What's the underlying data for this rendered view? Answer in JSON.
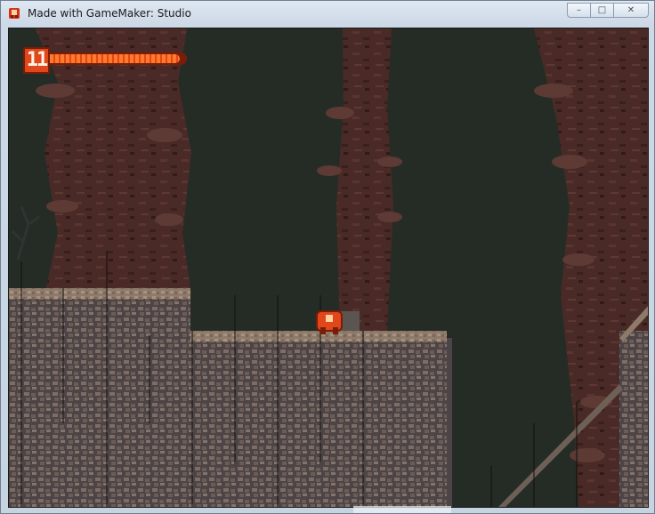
{
  "window": {
    "title": "Made with GameMaker: Studio",
    "controls": {
      "minimize": "–",
      "maximize": "□",
      "close": "✕"
    }
  },
  "hud": {
    "lives": "11",
    "health_fraction": 0.96,
    "health_color": "#e0471a"
  },
  "icons": [
    "gamemaker-icon",
    "minimize-icon",
    "maximize-icon",
    "close-icon"
  ]
}
